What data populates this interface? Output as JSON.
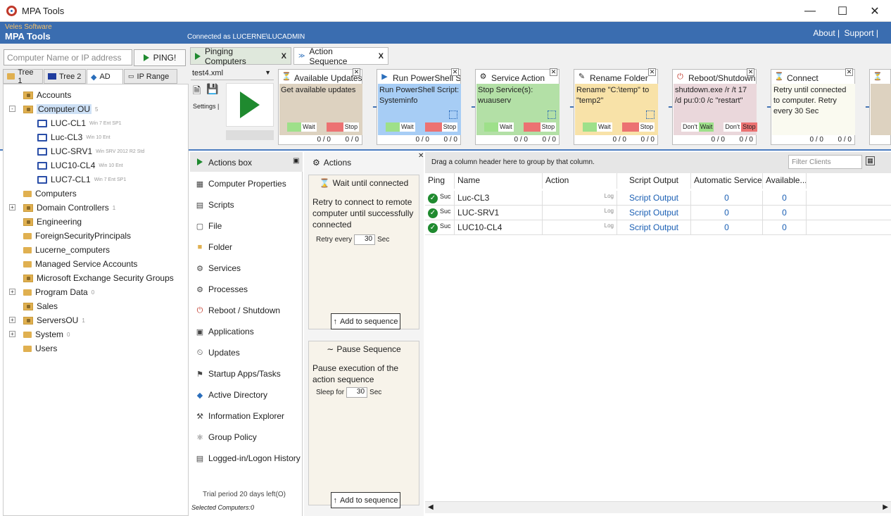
{
  "window": {
    "title": "MPA Tools"
  },
  "header": {
    "vendor": "Veles Software",
    "app": "MPA Tools",
    "connected": "Connected as LUCERNE\\LUCADMIN",
    "about": "About |",
    "support": "Support |"
  },
  "ping": {
    "placeholder": "Computer Name or IP address",
    "button": "PING!"
  },
  "left_tabs": [
    "Tree 1",
    "Tree 2",
    "AD",
    "IP Range"
  ],
  "tree": [
    {
      "label": "Accounts",
      "sub": ""
    },
    {
      "label": "Computer OU",
      "sub": "5"
    },
    {
      "label": "LUC-CL1",
      "sub": "Win 7 Ent SP1"
    },
    {
      "label": "Luc-CL3",
      "sub": "Win 10 Ent"
    },
    {
      "label": "LUC-SRV1",
      "sub": "Win SRV 2012 R2 Std"
    },
    {
      "label": "LUC10-CL4",
      "sub": "Win 10 Ent"
    },
    {
      "label": "LUC7-CL1",
      "sub": "Win 7 Ent SP1"
    },
    {
      "label": "Computers",
      "sub": ""
    },
    {
      "label": "Domain Controllers",
      "sub": "1"
    },
    {
      "label": "Engineering",
      "sub": ""
    },
    {
      "label": "ForeignSecurityPrincipals",
      "sub": ""
    },
    {
      "label": "Lucerne_computers",
      "sub": ""
    },
    {
      "label": "Managed Service Accounts",
      "sub": ""
    },
    {
      "label": "Microsoft Exchange Security Groups",
      "sub": ""
    },
    {
      "label": "Program Data",
      "sub": "0"
    },
    {
      "label": "Sales",
      "sub": ""
    },
    {
      "label": "ServersOU",
      "sub": "1"
    },
    {
      "label": "System",
      "sub": "0"
    },
    {
      "label": "Users",
      "sub": ""
    }
  ],
  "right_tabs": [
    "Pinging Computers",
    "Action Sequence"
  ],
  "tab_close": "X",
  "sequence": {
    "file": "test4.xml",
    "settings": "Settings |"
  },
  "cards": [
    {
      "title": "Available Updates",
      "body": "Get available updates",
      "wait": "Wait",
      "stop": "Stop",
      "count": "0 / 0",
      "color": "#ddd2c0"
    },
    {
      "title": "Run PowerShell Script",
      "body": "Run PowerShell Script: Systeminfo",
      "wait": "Wait",
      "stop": "Stop",
      "count": "0 / 0",
      "color": "#a7cdf5"
    },
    {
      "title": "Service Action",
      "body": "Stop Service(s): wuauserv",
      "wait": "Wait",
      "stop": "Stop",
      "count": "0 / 0",
      "color": "#b3e0a6"
    },
    {
      "title": "Rename Folder",
      "body": "Rename \"C:\\temp\" to \"temp2\"",
      "wait": "Wait",
      "stop": "Stop",
      "count": "0 / 0",
      "color": "#f8e2a8"
    },
    {
      "title": "Reboot/Shutdown",
      "body": "shutdown.exe  /r /t 17 /d pu:0:0 /c \"restart\"",
      "wait": "Wait",
      "stop": "Stop",
      "dont": "Don't",
      "count": "0 / 0",
      "color": "#ead7db"
    },
    {
      "title": "Connect",
      "body": "Retry until connected to computer. Retry every 30 Sec",
      "count": "0 / 0",
      "color": "#fafaf0"
    }
  ],
  "actions_menu": {
    "title": "Actions box",
    "items": [
      "Computer Properties",
      "Scripts",
      "File",
      "Folder",
      "Services",
      "Processes",
      "Reboot / Shutdown",
      "Applications",
      "Updates",
      "Startup Apps/Tasks",
      "Active Directory",
      "Information Explorer",
      "Group Policy",
      "Logged-in/Logon History"
    ],
    "trial": "Trial period 20 days left(O)",
    "selected": "Selected Computers:0"
  },
  "actions": {
    "title": "Actions",
    "wait": {
      "title": "Wait until connected",
      "desc": "Retry to connect to remote computer until successfully connected",
      "label": "Retry every",
      "value": "30",
      "unit": "Sec",
      "add": "Add to sequence"
    },
    "pause": {
      "title": "Pause Sequence",
      "desc": "Pause execution of the action sequence",
      "label": "Sleep for",
      "value": "30",
      "unit": "Sec",
      "add": "Add to sequence"
    }
  },
  "grid": {
    "drag_hint": "Drag a column header here to group by that column.",
    "filter": "Filter Clients",
    "columns": [
      "Ping",
      "Name",
      "Action",
      "Script Output",
      "Automatic Services",
      "Available..."
    ],
    "rows": [
      {
        "ping": "Suc",
        "name": "Luc-CL3",
        "log": "Log",
        "output": "Script Output",
        "auto": "0",
        "avail": "0"
      },
      {
        "ping": "Suc",
        "name": "LUC-SRV1",
        "log": "Log",
        "output": "Script Output",
        "auto": "0",
        "avail": "0"
      },
      {
        "ping": "Suc",
        "name": "LUC10-CL4",
        "log": "Log",
        "output": "Script Output",
        "auto": "0",
        "avail": "0"
      }
    ]
  }
}
